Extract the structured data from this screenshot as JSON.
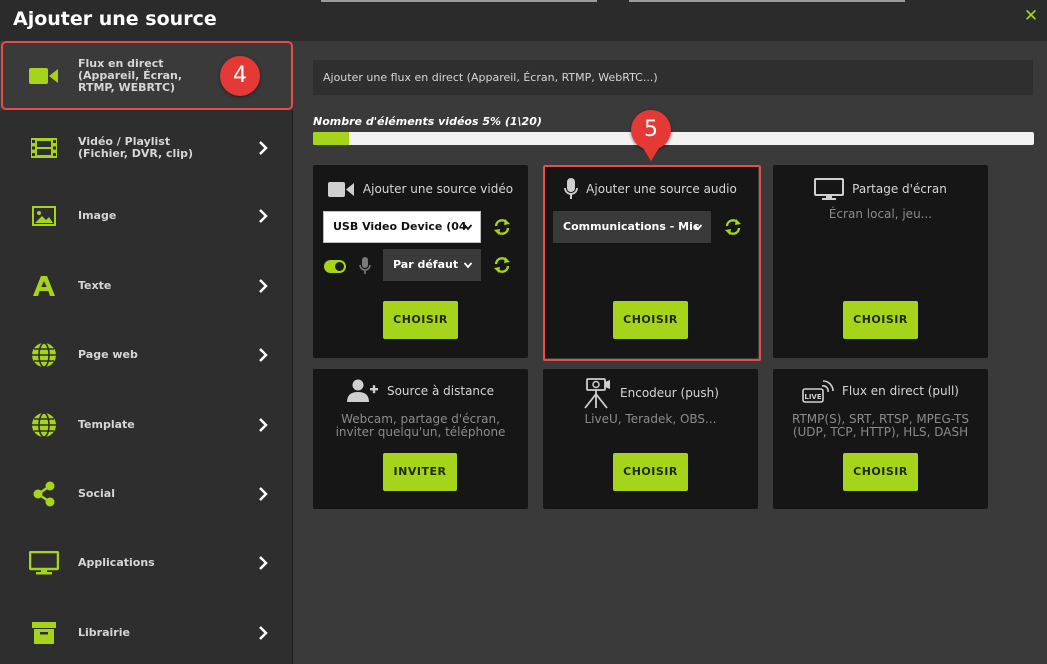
{
  "title": "Ajouter une source",
  "close_icon": "close-icon",
  "colors": {
    "accent": "#a6d41a",
    "highlight": "#e94a4a",
    "badge": "#e53935"
  },
  "sidebar": {
    "items": [
      {
        "label": "Flux en direct\n(Appareil, Écran,\nRTMP, WEBRTC)",
        "icon": "video-camera-icon"
      },
      {
        "label": "Vidéo / Playlist\n(Fichier, DVR, clip)",
        "icon": "film-icon"
      },
      {
        "label": "Image",
        "icon": "image-icon"
      },
      {
        "label": "Texte",
        "icon": "text-icon"
      },
      {
        "label": "Page web",
        "icon": "globe-icon"
      },
      {
        "label": "Template",
        "icon": "globe-icon"
      },
      {
        "label": "Social",
        "icon": "share-icon"
      },
      {
        "label": "Applications",
        "icon": "monitor-icon"
      },
      {
        "label": "Librairie",
        "icon": "archive-icon"
      }
    ]
  },
  "annotations": {
    "badge_4": "4",
    "badge_5": "5"
  },
  "main": {
    "info_text": "Ajouter une flux en direct (Appareil, Écran, RTMP, WebRTC...)",
    "progress_label": "Nombre d'éléments vidéos 5% (1\\20)",
    "progress_value": 0.05,
    "cards": {
      "video": {
        "title": "Ajouter une source vidéo",
        "device_select": "USB Video Device (04",
        "audio_select": "Par défaut",
        "button": "CHOISIR"
      },
      "audio": {
        "title": "Ajouter une source audio",
        "device_select": "Communications - Mic",
        "button": "CHOISIR"
      },
      "screen": {
        "title": "Partage d'écran",
        "desc": "Écran local, jeu...",
        "button": "CHOISIR"
      },
      "remote": {
        "title": "Source à distance",
        "desc": "Webcam, partage d'écran, inviter quelqu'un, téléphone",
        "button": "INVITER"
      },
      "encoder": {
        "title": "Encodeur (push)",
        "desc": "LiveU, Teradek, OBS...",
        "button": "CHOISIR"
      },
      "pull": {
        "title": "Flux en direct (pull)",
        "desc": "RTMP(S), SRT, RTSP, MPEG-TS (UDP, TCP, HTTP), HLS, DASH",
        "button": "CHOISIR"
      }
    }
  }
}
